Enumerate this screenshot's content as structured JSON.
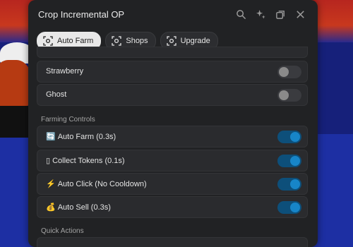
{
  "window": {
    "title": "Crop Incremental OP"
  },
  "titlebar_icons": [
    "search-icon",
    "sparkle-icon",
    "restore-icon",
    "close-icon"
  ],
  "tabs": [
    {
      "label": "Auto Farm",
      "active": true
    },
    {
      "label": "Shops",
      "active": false
    },
    {
      "label": "Upgrade",
      "active": false
    }
  ],
  "rows": [
    {
      "label": "Strawberry",
      "on": false
    },
    {
      "label": "Ghost",
      "on": false
    }
  ],
  "sections": {
    "farming_controls": "Farming Controls",
    "quick_actions": "Quick Actions"
  },
  "controls": [
    {
      "icon": "🔄",
      "label": "Auto Farm (0.3s)",
      "on": true
    },
    {
      "icon": "▯",
      "label": "Collect Tokens (0.1s)",
      "on": true
    },
    {
      "icon": "⚡",
      "label": "Auto Click (No Cooldown)",
      "on": true
    },
    {
      "icon": "💰",
      "label": "Auto Sell (0.3s)",
      "on": true
    }
  ],
  "colors": {
    "toggle_on": "#1785c8",
    "window_bg": "#212224"
  }
}
